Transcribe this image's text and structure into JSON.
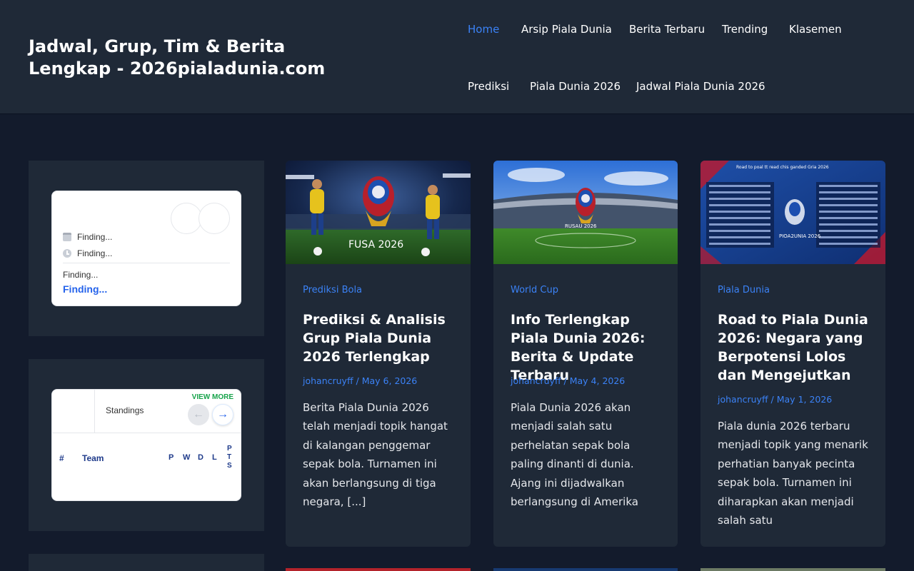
{
  "site": {
    "title": "Jadwal, Grup, Tim & Berita Lengkap - 2026pialadunia.com"
  },
  "nav": [
    {
      "label": "Home",
      "active": true
    },
    {
      "label": "Arsip Piala Dunia"
    },
    {
      "label": "Berita Terbaru"
    },
    {
      "label": "Trending"
    },
    {
      "label": "Klasemen"
    },
    {
      "label": "Prediksi"
    },
    {
      "label": "Piala Dunia 2026"
    },
    {
      "label": "Jadwal Piala Dunia 2026"
    }
  ],
  "match_widget": {
    "date": "Finding...",
    "time": "Finding...",
    "venue": "Finding...",
    "status": "Finding..."
  },
  "standings_widget": {
    "title": "Standings",
    "view_more": "VIEW MORE",
    "columns": {
      "rank": "#",
      "team": "Team",
      "p": "P",
      "w": "W",
      "d": "D",
      "l": "L",
      "pts": "PTS"
    }
  },
  "posts": [
    {
      "category": "Prediksi Bola",
      "title": "Prediksi & Analisis Grup Piala Dunia 2026 Terlengkap",
      "meta": "johancruyff / May 6, 2026",
      "excerpt": "Berita Piala Dunia 2026 telah menjadi topik hangat di kalangan penggemar sepak bola. Turnamen ini akan berlangsung di tiga negara, [...]",
      "image_text": "FUSA 2026"
    },
    {
      "category": "World Cup",
      "title": "Info Terlengkap Piala Dunia 2026: Berita & Update Terbaru",
      "meta": "johancruyff / May 4, 2026",
      "excerpt": "Piala Dunia 2026 akan menjadi salah satu perhelatan sepak bola paling dinanti di dunia. Ajang ini dijadwalkan berlangsung di Amerika",
      "image_text": "RUSAU 2026"
    },
    {
      "category": "Piala Dunia",
      "title": "Road to Piala Dunia 2026: Negara yang Berpotensi Lolos dan Mengejutkan",
      "meta": "johancruyff / May 1, 2026",
      "excerpt": "Piala dunia 2026 terbaru menjadi topik yang menarik perhatian banyak pecinta sepak bola. Turnamen ini diharapkan akan menjadi salah satu",
      "image_text": "Road to poal tt read chis ganded Gria 2026",
      "image_text2": "PIOA2UNIA 2026"
    }
  ],
  "colors": {
    "accent": "#3b82f6",
    "background": "#131b2c",
    "surface": "#1f2937",
    "link_green": "#16a34a"
  }
}
